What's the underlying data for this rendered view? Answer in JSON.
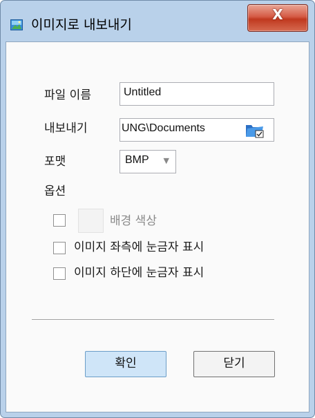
{
  "window": {
    "title": "이미지로 내보내기",
    "close_label": "X"
  },
  "form": {
    "filename_label": "파일 이름",
    "filename_value": "Untitled",
    "export_label": "내보내기",
    "export_path": "UNG\\Documents",
    "format_label": "포맷",
    "format_value": "BMP",
    "options_label": "옵션"
  },
  "options": {
    "background_color_label": "배경 색상",
    "background_color_checked": false,
    "background_color_enabled": false,
    "left_ruler_label": "이미지 좌측에 눈금자 표시",
    "left_ruler_checked": false,
    "bottom_ruler_label": "이미지 하단에 눈금자 표시",
    "bottom_ruler_checked": false
  },
  "buttons": {
    "ok_label": "확인",
    "close_label": "닫기"
  },
  "colors": {
    "frame": "#b9d1ea",
    "close_button": "#c7432b",
    "ok_button": "#cfe5f8",
    "disabled_text": "#8a8a8a"
  },
  "icons": {
    "app": "image-icon",
    "browse": "folder-icon",
    "dropdown": "chevron-down-icon"
  }
}
